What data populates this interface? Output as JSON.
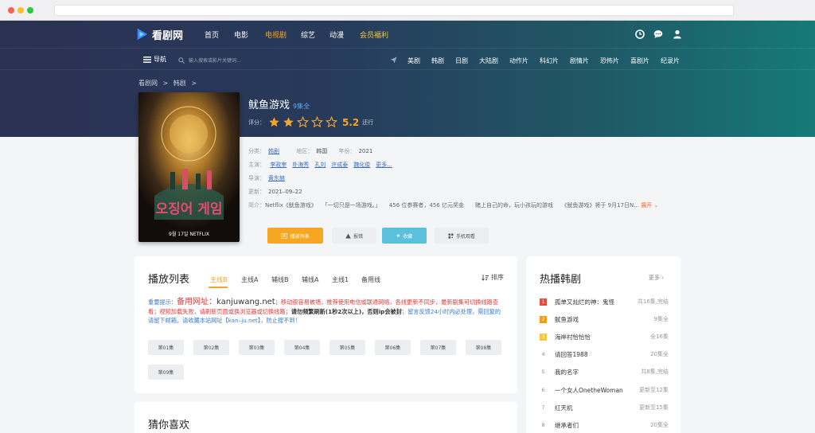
{
  "colors": {
    "accent": "#f5a623",
    "link": "#3a6fc4",
    "header_start": "#2b3153",
    "header_end": "#157a78",
    "fav_button": "#5bc0de",
    "rank1": "#e74c3c",
    "rank2": "#f39c12",
    "rank3": "#f5c842"
  },
  "site": {
    "logo_text": "看剧网"
  },
  "topnav": {
    "items": [
      "首页",
      "电影",
      "电视剧",
      "综艺",
      "动漫",
      "会员福利"
    ],
    "active": "电视剧",
    "icons": [
      "clock-icon",
      "chat-icon",
      "user-icon"
    ]
  },
  "subnav": {
    "menu_label": "导航",
    "search_placeholder": "输入搜索或影片关键词...",
    "categories": [
      "美剧",
      "韩剧",
      "日剧",
      "大陆剧",
      "动作片",
      "科幻片",
      "剧情片",
      "恐怖片",
      "喜剧片",
      "纪录片"
    ]
  },
  "breadcrumb": {
    "home": "看剧网",
    "sep": ">",
    "section": "韩剧",
    "tail": ">"
  },
  "show": {
    "title": "鱿鱼游戏",
    "episodes_badge": "9集全",
    "rating_label": "评分：",
    "rating_value": "5.2",
    "rating_unit": "还行",
    "rating_stars": 2,
    "category_label": "分类：",
    "category": "韩剧",
    "region_label": "地区：",
    "region": "韩国",
    "year_label": "年份：",
    "year": "2021",
    "cast_label": "主演：",
    "cast": [
      "李政宰",
      "朴海秀",
      "孔刘",
      "许成泰",
      "魏化俊",
      "更多..."
    ],
    "director_label": "导演：",
    "director": "黄东赫",
    "updated_label": "更新：",
    "updated": "2021–09–22",
    "desc_label": "简介：",
    "desc": "Netflix《鱿鱼游戏》　　「一切只是一场游戏。」　　456 位参赛者，456 亿元奖金　　赌上自己的命，玩小孩玩的游戏　　《鱿鱼游戏》将于 9月17日N...",
    "desc_more": "展开 ⌄"
  },
  "actions": {
    "play": "播放列表",
    "report": "报错",
    "favorite": "收藏",
    "mobile": "手机观看"
  },
  "playlist": {
    "title": "播放列表",
    "tabs": [
      "主线B",
      "主线A",
      "辅线B",
      "辅线A",
      "主线1",
      "备用线"
    ],
    "active_tab": "主线B",
    "sort_label": "排序",
    "notice": {
      "label": "重要提示：",
      "alt_label": "备用网址：",
      "alt_url": "kanjuwang.net",
      "p1": "；移动很容易被墙，推荐使用电信或联通网络，各线更新不同步，最新剧集可切换线路查看；视频加载失败，请刷新页面或换浏览器或切换线路；",
      "p2": "请勿频繁刷新(1秒2次以上)，否则ip会被封",
      "p3": "；留言反馈24小时内必处理，需回复的请留下邮箱。请收藏本站网址【kan–ju.net】，防止搜不到！"
    },
    "episodes": [
      "第01集",
      "第02集",
      "第03集",
      "第04集",
      "第05集",
      "第06集",
      "第07集",
      "第08集",
      "第09集"
    ]
  },
  "hot": {
    "title": "热播韩剧",
    "more": "更多 ›",
    "items": [
      {
        "rank": "1",
        "name": "孤单又灿烂的神：鬼怪",
        "status": "共16集,完结"
      },
      {
        "rank": "2",
        "name": "鱿鱼游戏",
        "status": "9集全"
      },
      {
        "rank": "3",
        "name": "海岸村恰恰恰",
        "status": "全16集"
      },
      {
        "rank": "4",
        "name": "请回答1988",
        "status": "20集全"
      },
      {
        "rank": "5",
        "name": "我的名字",
        "status": "共8集,完结"
      },
      {
        "rank": "6",
        "name": "一个女人OnetheWoman",
        "status": "更新至12集"
      },
      {
        "rank": "7",
        "name": "红天机",
        "status": "更新至15集"
      },
      {
        "rank": "8",
        "name": "继承者们",
        "status": "20集全"
      }
    ]
  },
  "guess": {
    "title": "猜你喜欢"
  },
  "poster": {
    "title_text": "오징어 게임",
    "caption": "9월 17일 NETFLIX"
  }
}
